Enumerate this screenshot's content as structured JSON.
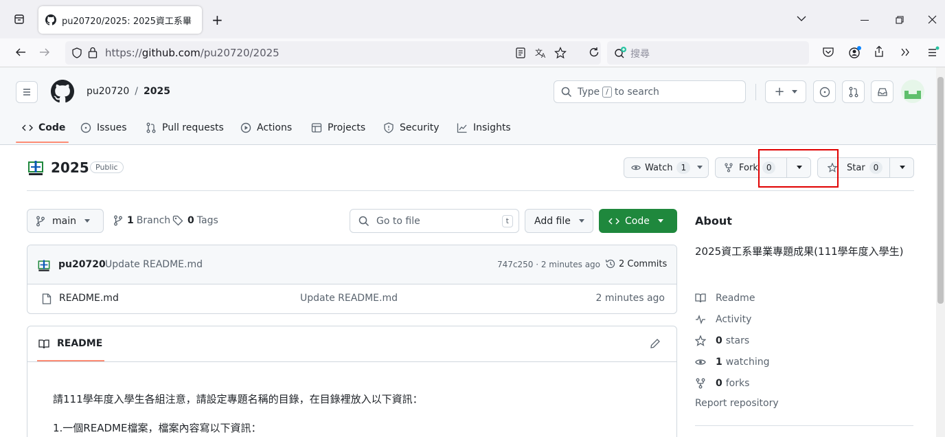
{
  "browser": {
    "tab_title": "pu20720/2025: 2025資工系畢 ×",
    "new_tab": "+",
    "url_prefix": "https://",
    "url_domain": "github.com",
    "url_path": "/pu20720/2025",
    "search_placeholder": "搜尋"
  },
  "header": {
    "owner": "pu20720",
    "separator": "/",
    "repo": "2025",
    "search_prefix": "Type",
    "search_key": "/",
    "search_suffix": "to search",
    "plus": "+"
  },
  "nav": {
    "code": "Code",
    "issues": "Issues",
    "pulls": "Pull requests",
    "actions": "Actions",
    "projects": "Projects",
    "security": "Security",
    "insights": "Insights"
  },
  "repo": {
    "name": "2025",
    "visibility": "Public",
    "watch_label": "Watch",
    "watch_count": "1",
    "fork_label": "Fork",
    "fork_count": "0",
    "star_label": "Star",
    "star_count": "0"
  },
  "toolbar": {
    "branch": "main",
    "branch_count": "1",
    "branch_label": "Branch",
    "tag_count": "0",
    "tag_label": "Tags",
    "goto_file": "Go to file",
    "goto_key": "t",
    "add_file": "Add file",
    "code_button": "Code"
  },
  "commit": {
    "author": "pu20720",
    "message": "Update README.md",
    "hash_time": "747c250 · 2 minutes ago",
    "commits": "2 Commits"
  },
  "files": [
    {
      "name": "README.md",
      "message": "Update README.md",
      "time": "2 minutes ago"
    }
  ],
  "readme": {
    "title": "README",
    "line1": "請111學年度入學生各組注意，請設定專題名稱的目錄，在目錄裡放入以下資訊：",
    "line2": "1.一個README檔案，檔案內容寫以下資訊："
  },
  "about": {
    "heading": "About",
    "description": "2025資工系畢業專題成果(111學年度入學生)",
    "readme": "Readme",
    "activity": "Activity",
    "stars_count": "0",
    "stars_label": "stars",
    "watching_count": "1",
    "watching_label": "watching",
    "forks_count": "0",
    "forks_label": "forks",
    "report": "Report repository"
  },
  "colors": {
    "accent_green": "#1f883d",
    "highlight_red": "#e00000",
    "nav_underline": "#fd8c73"
  }
}
